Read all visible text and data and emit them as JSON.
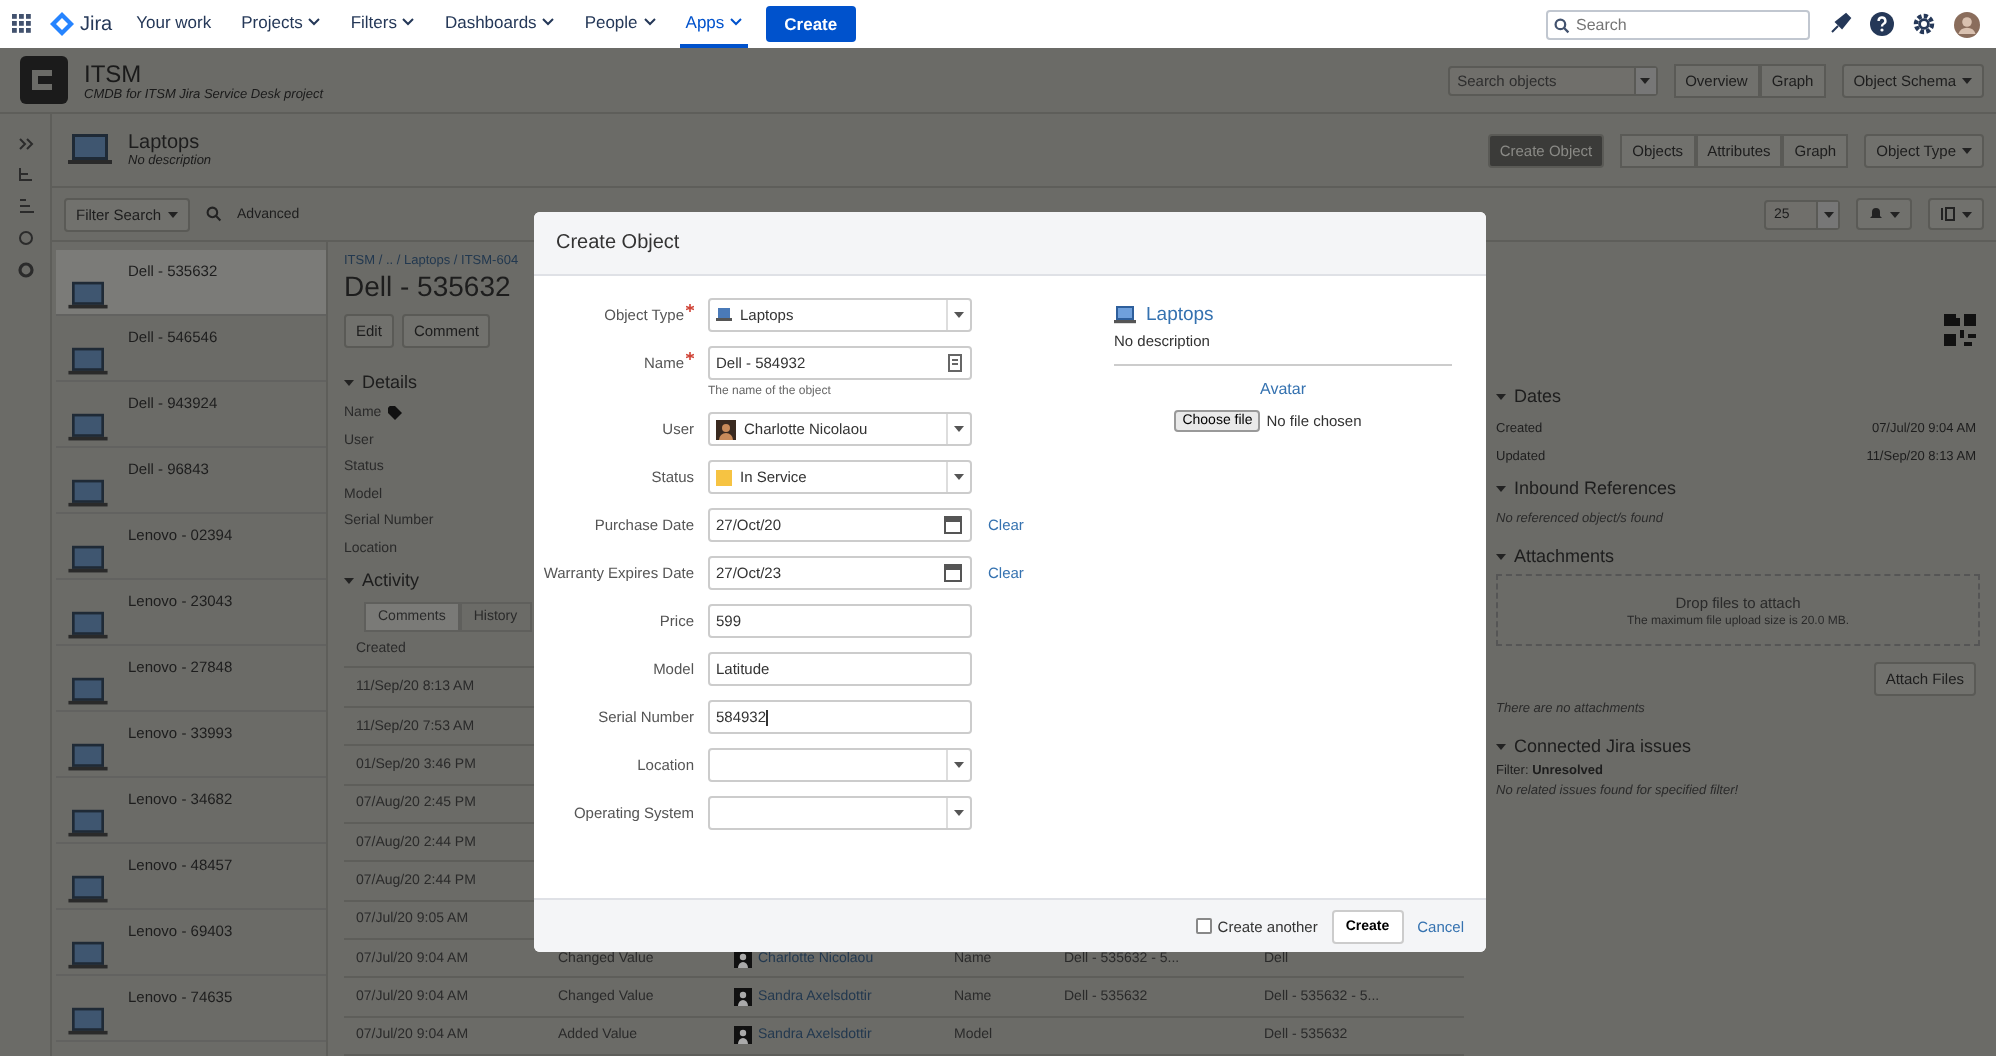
{
  "nav": {
    "product": "Jira",
    "items": [
      {
        "label": "Your work",
        "dropdown": false,
        "selected": false
      },
      {
        "label": "Projects",
        "dropdown": true,
        "selected": false
      },
      {
        "label": "Filters",
        "dropdown": true,
        "selected": false
      },
      {
        "label": "Dashboards",
        "dropdown": true,
        "selected": false
      },
      {
        "label": "People",
        "dropdown": true,
        "selected": false
      },
      {
        "label": "Apps",
        "dropdown": true,
        "selected": true
      }
    ],
    "create": "Create",
    "search": {
      "placeholder": "Search"
    }
  },
  "project": {
    "title": "ITSM",
    "subtitle": "CMDB for ITSM Jira Service Desk project",
    "search": {
      "placeholder": "Search objects"
    },
    "buttons": [
      "Overview",
      "Graph"
    ],
    "menu": "Object Schema"
  },
  "object_type": {
    "title": "Laptops",
    "description": "No description",
    "create": "Create Object",
    "tabs": [
      "Objects",
      "Attributes",
      "Graph"
    ],
    "menu": "Object Type"
  },
  "filter": {
    "button": "Filter Search",
    "advanced": "Advanced",
    "page_size": "25"
  },
  "objects": [
    {
      "name": "Dell - 535632",
      "selected": true
    },
    {
      "name": "Dell - 546546",
      "selected": false
    },
    {
      "name": "Dell - 943924",
      "selected": false
    },
    {
      "name": "Dell - 96843",
      "selected": false
    },
    {
      "name": "Lenovo - 02394",
      "selected": false
    },
    {
      "name": "Lenovo - 23043",
      "selected": false
    },
    {
      "name": "Lenovo - 27848",
      "selected": false
    },
    {
      "name": "Lenovo - 33993",
      "selected": false
    },
    {
      "name": "Lenovo - 34682",
      "selected": false
    },
    {
      "name": "Lenovo - 48457",
      "selected": false
    },
    {
      "name": "Lenovo - 69403",
      "selected": false
    },
    {
      "name": "Lenovo - 74635",
      "selected": false
    }
  ],
  "detail": {
    "breadcrumb": "ITSM / .. / Laptops / ITSM-604",
    "title": "Dell - 535632",
    "actions": [
      "Edit",
      "Comment"
    ],
    "details": {
      "heading": "Details",
      "labels": [
        {
          "label": "Name",
          "key": true
        },
        {
          "label": "User",
          "key": false
        },
        {
          "label": "Status",
          "key": false
        },
        {
          "label": "Model",
          "key": false
        },
        {
          "label": "Serial Number",
          "key": false
        },
        {
          "label": "Location",
          "key": false
        }
      ]
    },
    "activity": {
      "heading": "Activity",
      "tabs": [
        {
          "label": "Comments",
          "selected": true
        },
        {
          "label": "History",
          "selected": false
        }
      ],
      "column": "Created",
      "rows": [
        {
          "created": "11/Sep/20 8:13 AM"
        },
        {
          "created": "11/Sep/20 7:53 AM"
        },
        {
          "created": "01/Sep/20 3:46 PM"
        },
        {
          "created": "07/Aug/20 2:45 PM"
        },
        {
          "created": "07/Aug/20 2:44 PM"
        },
        {
          "created": "07/Aug/20 2:44 PM"
        },
        {
          "created": "07/Jul/20 9:05 AM"
        },
        {
          "created": "07/Jul/20 9:04 AM",
          "action": "Changed Value",
          "user": "Charlotte Nicolaou",
          "attribute": "Name",
          "old": "Dell - 535632 - 5...",
          "new": "Dell"
        },
        {
          "created": "07/Jul/20 9:04 AM",
          "action": "Changed Value",
          "user": "Sandra Axelsdottir",
          "attribute": "Name",
          "old": "Dell - 535632",
          "new": "Dell - 535632 - 5..."
        },
        {
          "created": "07/Jul/20 9:04 AM",
          "action": "Added Value",
          "user": "Sandra Axelsdottir",
          "attribute": "Model",
          "new": "Dell - 535632"
        }
      ]
    }
  },
  "side": {
    "dates": {
      "heading": "Dates",
      "rows": [
        {
          "label": "Created",
          "value": "07/Jul/20 9:04 AM"
        },
        {
          "label": "Updated",
          "value": "11/Sep/20 8:13 AM"
        }
      ]
    },
    "inbound": {
      "heading": "Inbound References",
      "empty": "No referenced object/s found"
    },
    "attachments": {
      "heading": "Attachments",
      "drop": "Drop files to attach",
      "limit": "The maximum file upload size is 20.0 MB.",
      "button": "Attach Files",
      "empty": "There are no attachments"
    },
    "issues": {
      "heading": "Connected Jira issues",
      "filter": "Filter: **Unresolved**",
      "empty": "No related issues found for specified filter!"
    }
  },
  "modal": {
    "title": "Create Object",
    "fields": [
      {
        "label": "Object Type",
        "required": true,
        "kind": "type",
        "value": "Laptops"
      },
      {
        "label": "Name",
        "required": true,
        "kind": "name",
        "value": "Dell - 584932",
        "hint": "The name of the object"
      },
      {
        "label": "User",
        "required": false,
        "kind": "user",
        "value": "Charlotte Nicolaou"
      },
      {
        "label": "Status",
        "required": false,
        "kind": "status",
        "color": "#f6c342",
        "value": "In Service"
      },
      {
        "label": "Purchase Date",
        "required": false,
        "kind": "date",
        "value": "27/Oct/20",
        "clear": "Clear"
      },
      {
        "label": "Warranty Expires Date",
        "required": false,
        "kind": "date",
        "value": "27/Oct/23",
        "clear": "Clear"
      },
      {
        "label": "Price",
        "required": false,
        "kind": "text",
        "value": "599"
      },
      {
        "label": "Model",
        "required": false,
        "kind": "text",
        "value": "Latitude"
      },
      {
        "label": "Serial Number",
        "required": false,
        "kind": "text",
        "value": "584932"
      },
      {
        "label": "Location",
        "required": false,
        "kind": "select"
      },
      {
        "label": "Operating System",
        "required": false,
        "kind": "select"
      }
    ],
    "preview": {
      "title": "Laptops",
      "description": "No description",
      "avatar": "Avatar",
      "file_button": "Choose file",
      "file_status": "No file chosen"
    },
    "footer": {
      "create_another": {
        "label": "Create another",
        "checked": false
      },
      "create": "Create",
      "cancel": "Cancel"
    }
  }
}
